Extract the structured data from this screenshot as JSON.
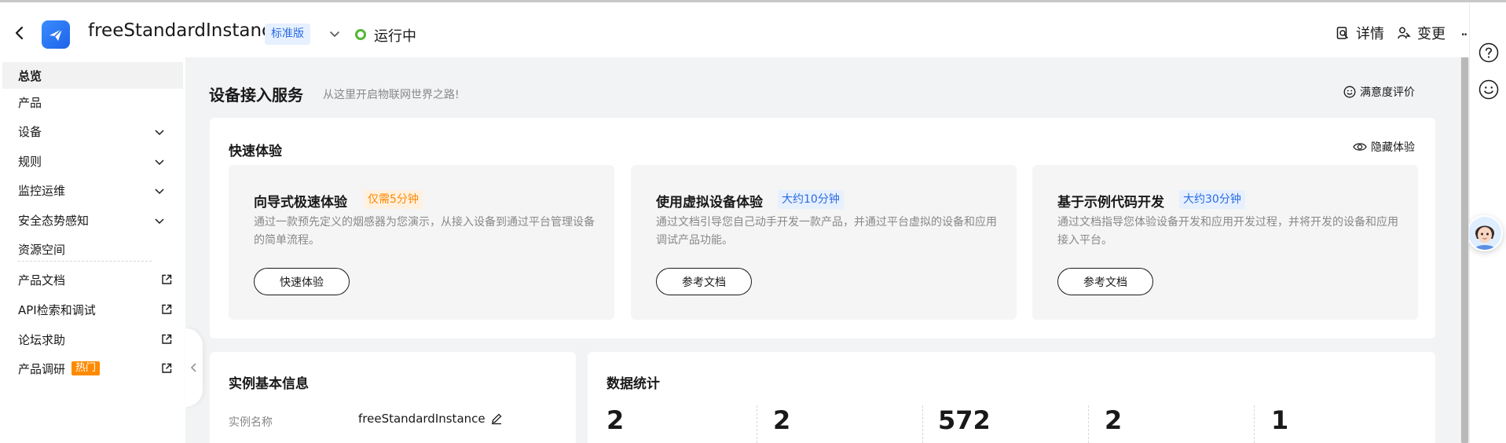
{
  "header": {
    "instance_name": "freeStandardInstance",
    "edition": "标准版",
    "status": "运行中",
    "status_color": "#52b833",
    "actions": [
      {
        "label": "详情",
        "icon": "detail-icon"
      },
      {
        "label": "变更",
        "icon": "change-icon"
      }
    ],
    "more_icon": "more-icon"
  },
  "sidebar": {
    "items": [
      {
        "label": "总览",
        "active": true
      },
      {
        "label": "产品"
      },
      {
        "label": "设备",
        "expandable": true
      },
      {
        "label": "规则",
        "expandable": true
      },
      {
        "label": "监控运维",
        "expandable": true
      },
      {
        "label": "安全态势感知",
        "expandable": true
      },
      {
        "label": "资源空间"
      },
      {
        "label": "产品文档",
        "external": true
      },
      {
        "label": "API检索和调试",
        "external": true
      },
      {
        "label": "论坛求助",
        "external": true
      },
      {
        "label": "产品调研",
        "external": true,
        "badge": "热门"
      }
    ],
    "badge_color": "#ff8a00"
  },
  "page": {
    "title": "设备接入服务",
    "subtitle": "从这里开启物联网世界之路!",
    "rating_link": "满意度评价"
  },
  "quick": {
    "title": "快速体验",
    "hide_link": "隐藏体验",
    "cards": [
      {
        "title": "向导式极速体验",
        "tag": "仅需5分钟",
        "tag_color": "orange",
        "desc": "通过一款预先定义的烟感器为您演示，从接入设备到通过平台管理设备的简单流程。",
        "button": "快速体验"
      },
      {
        "title": "使用虚拟设备体验",
        "tag": "大约10分钟",
        "tag_color": "blue",
        "desc": "通过文档引导您自己动手开发一款产品，并通过平台虚拟的设备和应用调试产品功能。",
        "button": "参考文档"
      },
      {
        "title": "基于示例代码开发",
        "tag": "大约30分钟",
        "tag_color": "blue",
        "desc": "通过文档指导您体验设备开发和应用开发过程，并将开发的设备和应用接入平台。",
        "button": "参考文档"
      }
    ]
  },
  "instance_info": {
    "title": "实例基本信息",
    "rows": [
      {
        "label": "实例名称",
        "value": "freeStandardInstance"
      }
    ]
  },
  "stats": {
    "title": "数据统计",
    "values": [
      "2",
      "2",
      "572",
      "2",
      "1"
    ]
  },
  "rail": {
    "icons": [
      "help-icon",
      "feedback-smile-icon"
    ]
  },
  "colors": {
    "accent": "#2a6be2",
    "background": "#f2f3f5"
  }
}
